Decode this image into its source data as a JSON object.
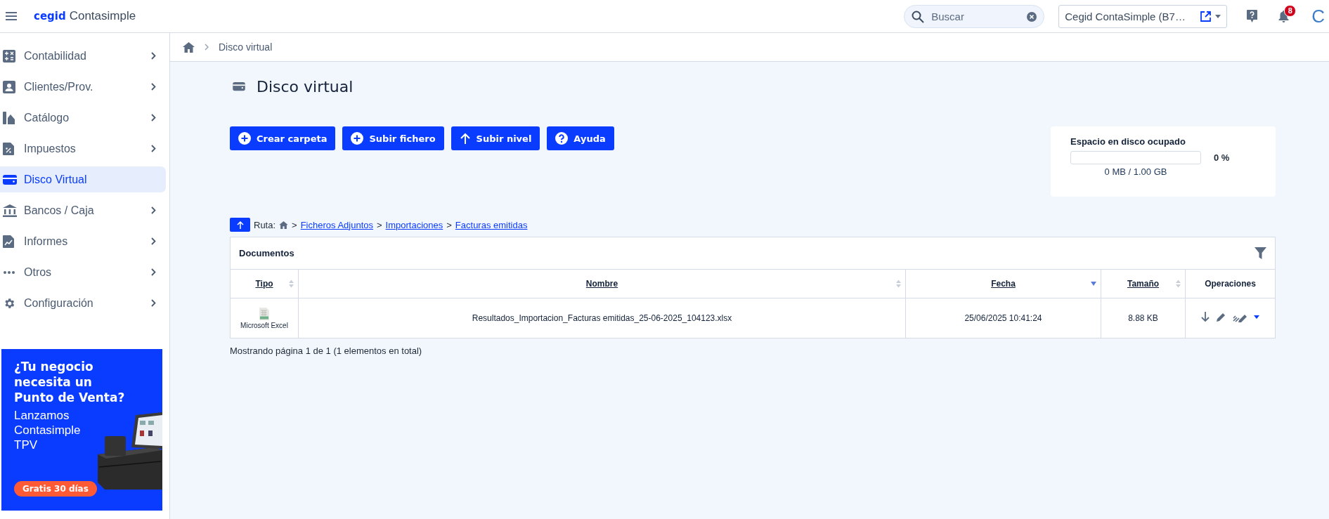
{
  "header": {
    "logo_brand": "cegid",
    "logo_product": "Contasimple",
    "search": {
      "placeholder": "Buscar"
    },
    "company": "Cegid ContaSimple (B7…",
    "notifications": "8",
    "user_initial": "C"
  },
  "sidebar": {
    "items": [
      {
        "label": "Contabilidad",
        "selected": false,
        "has_submenu": true
      },
      {
        "label": "Clientes/Prov.",
        "selected": false,
        "has_submenu": true
      },
      {
        "label": "Catálogo",
        "selected": false,
        "has_submenu": true
      },
      {
        "label": "Impuestos",
        "selected": false,
        "has_submenu": true
      },
      {
        "label": "Disco Virtual",
        "selected": true,
        "has_submenu": false
      },
      {
        "label": "Bancos / Caja",
        "selected": false,
        "has_submenu": true
      },
      {
        "label": "Informes",
        "selected": false,
        "has_submenu": true
      },
      {
        "label": "Otros",
        "selected": false,
        "has_submenu": true
      },
      {
        "label": "Configuración",
        "selected": false,
        "has_submenu": true
      }
    ],
    "promo": {
      "headline": "¿Tu negocio necesita un Punto de Venta?",
      "text": "Lanzamos Contasimple TPV",
      "button": "Gratis 30 días"
    }
  },
  "breadcrumb": {
    "current": "Disco virtual"
  },
  "page": {
    "title": "Disco virtual",
    "actions": [
      {
        "label": "Crear carpeta"
      },
      {
        "label": "Subir fichero"
      },
      {
        "label": "Subir nivel"
      },
      {
        "label": "Ayuda"
      }
    ],
    "disk_usage": {
      "title": "Espacio en disco ocupado",
      "level": 0,
      "percent": "0 %",
      "reading": "0 MB / 1.00 GB"
    },
    "path": {
      "label": "Ruta:",
      "parts": [
        {
          "kind": "home"
        },
        {
          "kind": "sep",
          "text": ">"
        },
        {
          "kind": "link",
          "text": "Ficheros Adjuntos"
        },
        {
          "kind": "sep",
          "text": ">"
        },
        {
          "kind": "link",
          "text": "Importaciones"
        },
        {
          "kind": "sep",
          "text": ">"
        },
        {
          "kind": "link",
          "text": "Facturas emitidas"
        }
      ]
    },
    "table": {
      "title": "Documentos",
      "columns": [
        {
          "label": "Tipo",
          "sortable": true,
          "sorted_descending": false
        },
        {
          "label": "Nombre",
          "sortable": true,
          "sorted_descending": false
        },
        {
          "label": "Fecha",
          "sortable": true,
          "sorted_descending": true
        },
        {
          "label": "Tamaño",
          "sortable": true,
          "sorted_descending": false
        },
        {
          "label": "Operaciones",
          "sortable": false
        }
      ],
      "rows": [
        {
          "type": "Microsoft Excel",
          "name": "Resultados_Importacion_Facturas emitidas_25-06-2025_104123.xlsx",
          "date": "25/06/2025 10:41:24",
          "size": "8.88 KB"
        }
      ]
    },
    "footer": "Mostrando página 1 de 1 (1 elementos en total)"
  }
}
